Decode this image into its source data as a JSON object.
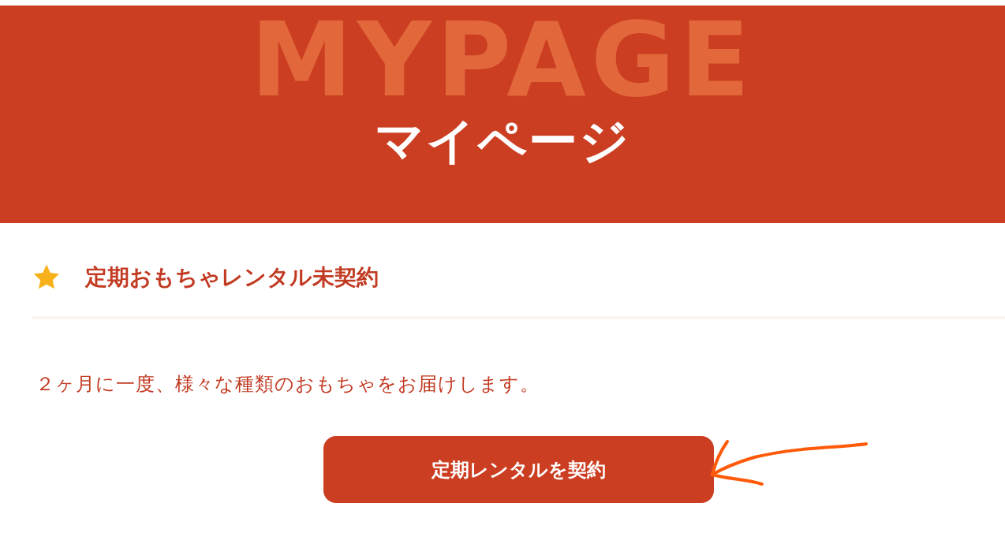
{
  "header": {
    "backdrop_text": "MYPAGE",
    "title": "マイページ"
  },
  "section": {
    "heading": "定期おもちゃレンタル未契約",
    "description": "２ヶ月に一度、様々な種類のおもちゃをお届けします。",
    "button": "定期レンタルを契約"
  }
}
